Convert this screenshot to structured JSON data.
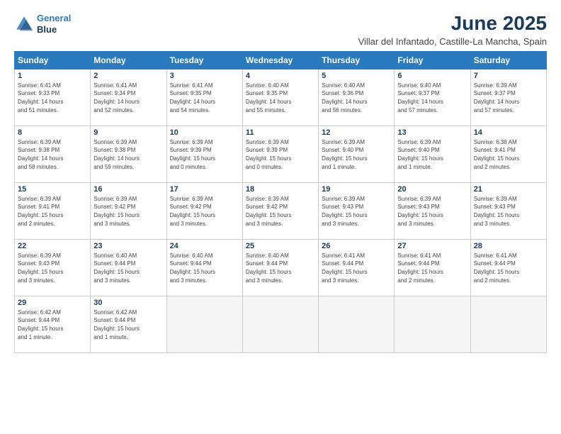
{
  "logo": {
    "line1": "General",
    "line2": "Blue"
  },
  "title": "June 2025",
  "subtitle": "Villar del Infantado, Castille-La Mancha, Spain",
  "weekdays": [
    "Sunday",
    "Monday",
    "Tuesday",
    "Wednesday",
    "Thursday",
    "Friday",
    "Saturday"
  ],
  "weeks": [
    [
      {
        "day": "1",
        "sunrise": "Sunrise: 6:41 AM",
        "sunset": "Sunset: 9:33 PM",
        "daylight": "Daylight: 14 hours and 51 minutes."
      },
      {
        "day": "2",
        "sunrise": "Sunrise: 6:41 AM",
        "sunset": "Sunset: 9:34 PM",
        "daylight": "Daylight: 14 hours and 52 minutes."
      },
      {
        "day": "3",
        "sunrise": "Sunrise: 6:41 AM",
        "sunset": "Sunset: 9:35 PM",
        "daylight": "Daylight: 14 hours and 54 minutes."
      },
      {
        "day": "4",
        "sunrise": "Sunrise: 6:40 AM",
        "sunset": "Sunset: 9:35 PM",
        "daylight": "Daylight: 14 hours and 55 minutes."
      },
      {
        "day": "5",
        "sunrise": "Sunrise: 6:40 AM",
        "sunset": "Sunset: 9:36 PM",
        "daylight": "Daylight: 14 hours and 56 minutes."
      },
      {
        "day": "6",
        "sunrise": "Sunrise: 6:40 AM",
        "sunset": "Sunset: 9:37 PM",
        "daylight": "Daylight: 14 hours and 57 minutes."
      },
      {
        "day": "7",
        "sunrise": "Sunrise: 6:39 AM",
        "sunset": "Sunset: 9:37 PM",
        "daylight": "Daylight: 14 hours and 57 minutes."
      }
    ],
    [
      {
        "day": "8",
        "sunrise": "Sunrise: 6:39 AM",
        "sunset": "Sunset: 9:38 PM",
        "daylight": "Daylight: 14 hours and 58 minutes."
      },
      {
        "day": "9",
        "sunrise": "Sunrise: 6:39 AM",
        "sunset": "Sunset: 9:38 PM",
        "daylight": "Daylight: 14 hours and 59 minutes."
      },
      {
        "day": "10",
        "sunrise": "Sunrise: 6:39 AM",
        "sunset": "Sunset: 9:39 PM",
        "daylight": "Daylight: 15 hours and 0 minutes."
      },
      {
        "day": "11",
        "sunrise": "Sunrise: 6:39 AM",
        "sunset": "Sunset: 9:39 PM",
        "daylight": "Daylight: 15 hours and 0 minutes."
      },
      {
        "day": "12",
        "sunrise": "Sunrise: 6:39 AM",
        "sunset": "Sunset: 9:40 PM",
        "daylight": "Daylight: 15 hours and 1 minute."
      },
      {
        "day": "13",
        "sunrise": "Sunrise: 6:39 AM",
        "sunset": "Sunset: 9:40 PM",
        "daylight": "Daylight: 15 hours and 1 minute."
      },
      {
        "day": "14",
        "sunrise": "Sunrise: 6:38 AM",
        "sunset": "Sunset: 9:41 PM",
        "daylight": "Daylight: 15 hours and 2 minutes."
      }
    ],
    [
      {
        "day": "15",
        "sunrise": "Sunrise: 6:39 AM",
        "sunset": "Sunset: 9:41 PM",
        "daylight": "Daylight: 15 hours and 2 minutes."
      },
      {
        "day": "16",
        "sunrise": "Sunrise: 6:39 AM",
        "sunset": "Sunset: 9:42 PM",
        "daylight": "Daylight: 15 hours and 3 minutes."
      },
      {
        "day": "17",
        "sunrise": "Sunrise: 6:39 AM",
        "sunset": "Sunset: 9:42 PM",
        "daylight": "Daylight: 15 hours and 3 minutes."
      },
      {
        "day": "18",
        "sunrise": "Sunrise: 6:39 AM",
        "sunset": "Sunset: 9:42 PM",
        "daylight": "Daylight: 15 hours and 3 minutes."
      },
      {
        "day": "19",
        "sunrise": "Sunrise: 6:39 AM",
        "sunset": "Sunset: 9:43 PM",
        "daylight": "Daylight: 15 hours and 3 minutes."
      },
      {
        "day": "20",
        "sunrise": "Sunrise: 6:39 AM",
        "sunset": "Sunset: 9:43 PM",
        "daylight": "Daylight: 15 hours and 3 minutes."
      },
      {
        "day": "21",
        "sunrise": "Sunrise: 6:39 AM",
        "sunset": "Sunset: 9:43 PM",
        "daylight": "Daylight: 15 hours and 3 minutes."
      }
    ],
    [
      {
        "day": "22",
        "sunrise": "Sunrise: 6:39 AM",
        "sunset": "Sunset: 9:43 PM",
        "daylight": "Daylight: 15 hours and 3 minutes."
      },
      {
        "day": "23",
        "sunrise": "Sunrise: 6:40 AM",
        "sunset": "Sunset: 9:44 PM",
        "daylight": "Daylight: 15 hours and 3 minutes."
      },
      {
        "day": "24",
        "sunrise": "Sunrise: 6:40 AM",
        "sunset": "Sunset: 9:44 PM",
        "daylight": "Daylight: 15 hours and 3 minutes."
      },
      {
        "day": "25",
        "sunrise": "Sunrise: 6:40 AM",
        "sunset": "Sunset: 9:44 PM",
        "daylight": "Daylight: 15 hours and 3 minutes."
      },
      {
        "day": "26",
        "sunrise": "Sunrise: 6:41 AM",
        "sunset": "Sunset: 9:44 PM",
        "daylight": "Daylight: 15 hours and 3 minutes."
      },
      {
        "day": "27",
        "sunrise": "Sunrise: 6:41 AM",
        "sunset": "Sunset: 9:44 PM",
        "daylight": "Daylight: 15 hours and 2 minutes."
      },
      {
        "day": "28",
        "sunrise": "Sunrise: 6:41 AM",
        "sunset": "Sunset: 9:44 PM",
        "daylight": "Daylight: 15 hours and 2 minutes."
      }
    ],
    [
      {
        "day": "29",
        "sunrise": "Sunrise: 6:42 AM",
        "sunset": "Sunset: 9:44 PM",
        "daylight": "Daylight: 15 hours and 1 minute."
      },
      {
        "day": "30",
        "sunrise": "Sunrise: 6:42 AM",
        "sunset": "Sunset: 9:44 PM",
        "daylight": "Daylight: 15 hours and 1 minute."
      },
      {
        "day": "",
        "sunrise": "",
        "sunset": "",
        "daylight": ""
      },
      {
        "day": "",
        "sunrise": "",
        "sunset": "",
        "daylight": ""
      },
      {
        "day": "",
        "sunrise": "",
        "sunset": "",
        "daylight": ""
      },
      {
        "day": "",
        "sunrise": "",
        "sunset": "",
        "daylight": ""
      },
      {
        "day": "",
        "sunrise": "",
        "sunset": "",
        "daylight": ""
      }
    ]
  ]
}
